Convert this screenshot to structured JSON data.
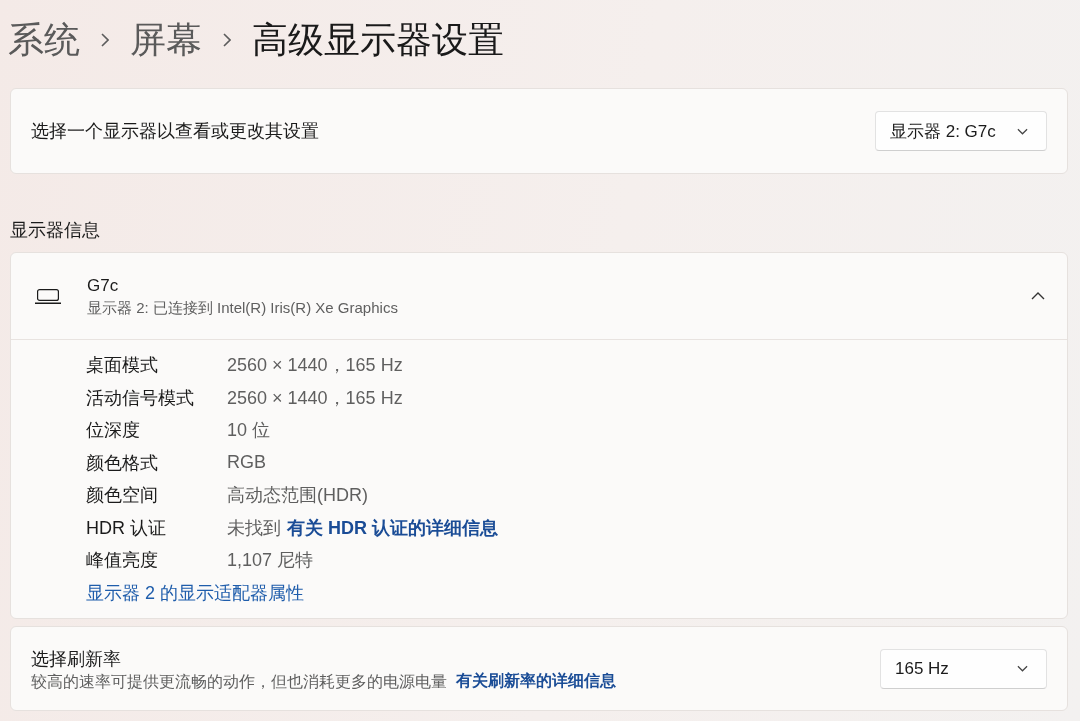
{
  "breadcrumb": [
    {
      "label": "系统",
      "current": false
    },
    {
      "label": "屏幕",
      "current": false
    },
    {
      "label": "高级显示器设置",
      "current": true
    }
  ],
  "display_select": {
    "label": "选择一个显示器以查看或更改其设置",
    "dropdown": {
      "value": "显示器 2: G7c"
    }
  },
  "display_info": {
    "heading": "显示器信息",
    "monitor": {
      "name": "G7c",
      "subtitle": "显示器 2: 已连接到 Intel(R) Iris(R) Xe Graphics",
      "expanded": true
    },
    "rows": [
      {
        "label": "桌面模式",
        "value": "2560 × 1440，165 Hz"
      },
      {
        "label": "活动信号模式",
        "value": "2560 × 1440，165 Hz"
      },
      {
        "label": "位深度",
        "value": "10 位"
      },
      {
        "label": "颜色格式",
        "value": "RGB"
      },
      {
        "label": "颜色空间",
        "value": "高动态范围(HDR)"
      },
      {
        "label": "HDR 认证",
        "value": "未找到",
        "link": "有关 HDR 认证的详细信息"
      },
      {
        "label": "峰值亮度",
        "value": "1,107 尼特"
      }
    ],
    "adapter_link": "显示器 2 的显示适配器属性"
  },
  "refresh_rate": {
    "title": "选择刷新率",
    "description": "较高的速率可提供更流畅的动作，但也消耗更多的电源电量",
    "link": "有关刷新率的详细信息",
    "dropdown": {
      "value": "165 Hz"
    }
  }
}
